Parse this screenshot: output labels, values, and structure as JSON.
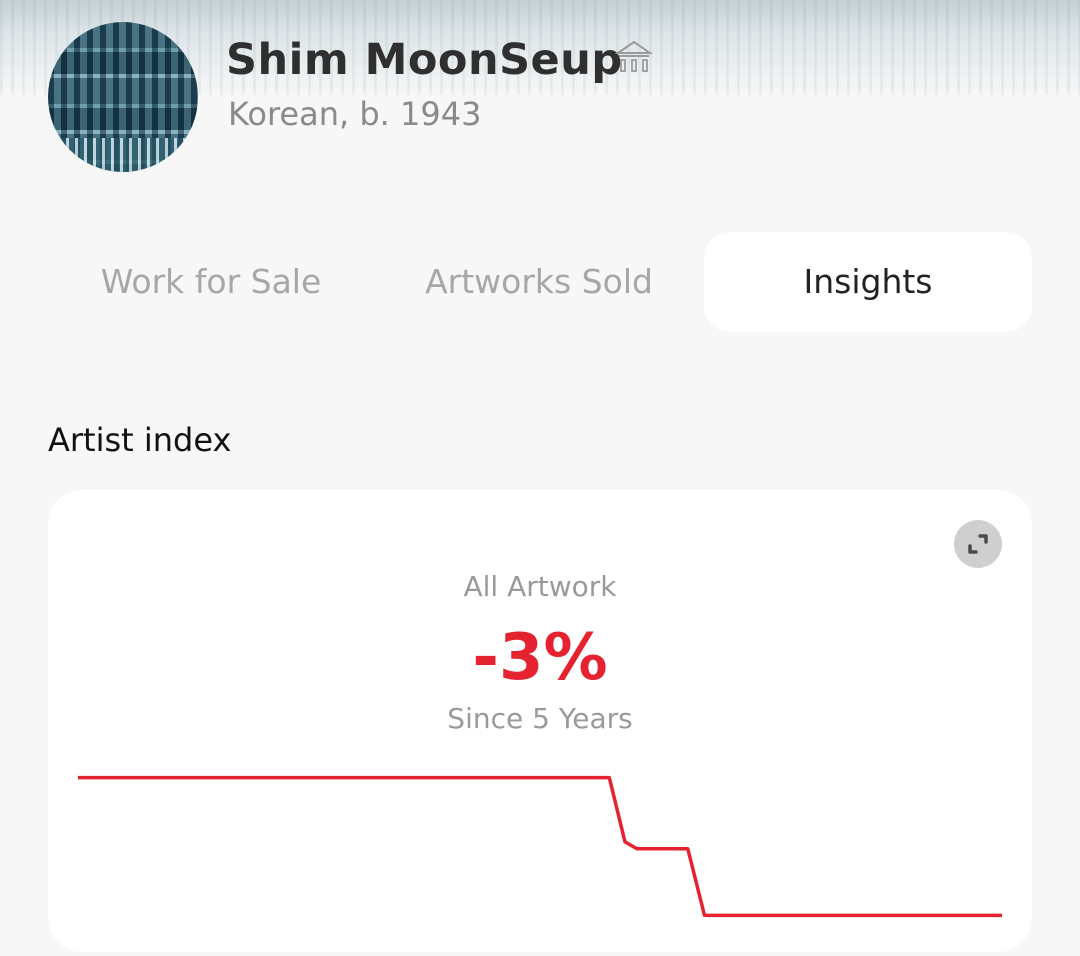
{
  "artist": {
    "name": "Shim MoonSeup",
    "meta": "Korean, b. 1943",
    "avatar_icon": "artwork-thumbnail",
    "badge_icon": "museum-icon"
  },
  "tabs": [
    {
      "label": "Work for Sale",
      "active": false
    },
    {
      "label": "Artworks Sold",
      "active": false
    },
    {
      "label": "Insights",
      "active": true
    }
  ],
  "section": {
    "title": "Artist index"
  },
  "index_card": {
    "category": "All Artwork",
    "change": "-3%",
    "period": "Since 5 Years",
    "expand_icon": "expand-icon",
    "accent_color": "#e52330"
  },
  "chart_data": {
    "type": "line",
    "title": "",
    "xlabel": "",
    "ylabel": "",
    "grid": false,
    "series": [
      {
        "color": "#e52330",
        "points": [
          {
            "x": 0.0,
            "y": 100.0
          },
          {
            "x": 0.575,
            "y": 100.0
          },
          {
            "x": 0.592,
            "y": 98.6
          },
          {
            "x": 0.605,
            "y": 98.45
          },
          {
            "x": 0.66,
            "y": 98.45
          },
          {
            "x": 0.678,
            "y": 97.0
          },
          {
            "x": 1.0,
            "y": 97.0
          }
        ]
      }
    ],
    "xlim": [
      0,
      1
    ],
    "ylim": [
      96.9,
      100.1
    ]
  }
}
